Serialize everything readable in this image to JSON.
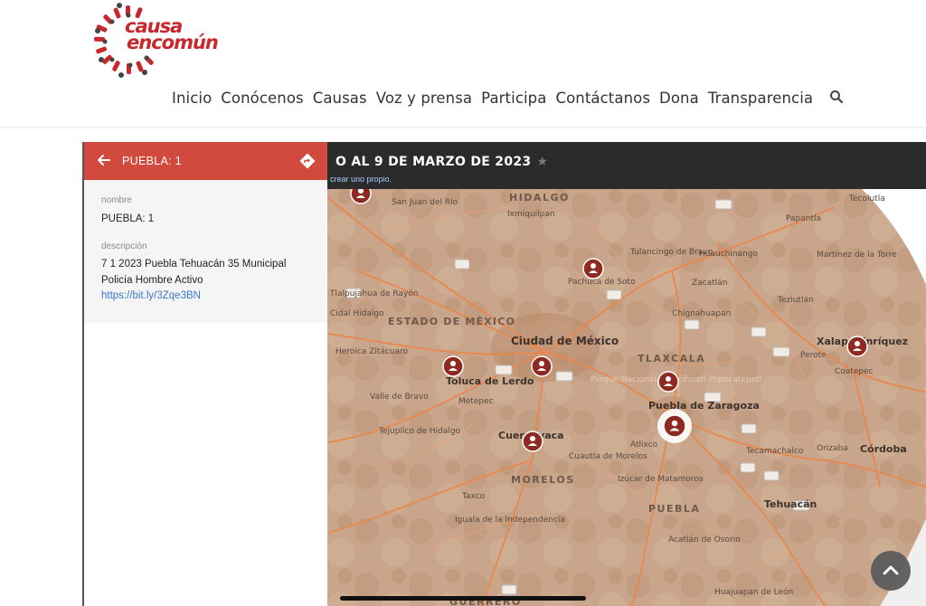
{
  "site": {
    "logo_line1": "causa",
    "logo_line2": "encomún",
    "brand_color": "#c8272d"
  },
  "nav": {
    "items": [
      "Inicio",
      "Conócenos",
      "Causas",
      "Voz y prensa",
      "Participa",
      "Contáctanos",
      "Dona",
      "Transparencia"
    ],
    "search_icon": "search-icon"
  },
  "map": {
    "title_visible": "O AL 9 DE MARZO DE 2023",
    "subtitle_visible": "crear uno propio.",
    "labels": [
      {
        "text": "HIDALGO"
      },
      {
        "text": "San Juan del Río"
      },
      {
        "text": "Ixmiquilpan"
      },
      {
        "text": "Tulancingo de Bravo"
      },
      {
        "text": "Huauchinango"
      },
      {
        "text": "Papantla"
      },
      {
        "text": "Tecolutla"
      },
      {
        "text": "Martínez de la Torre"
      },
      {
        "text": "Pachuca de Soto"
      },
      {
        "text": "Zacatlán"
      },
      {
        "text": "Teziutlán"
      },
      {
        "text": "Tlalpujahua de Rayón"
      },
      {
        "text": "ESTADO DE MÉXICO"
      },
      {
        "text": "Chignahuapan"
      },
      {
        "text": "Ciudad de México"
      },
      {
        "text": "TLAXCALA"
      },
      {
        "text": "Xalapa-Enríquez"
      },
      {
        "text": "Perote"
      },
      {
        "text": "Coatepec"
      },
      {
        "text": "Heroica Zitácuaro"
      },
      {
        "text": "Toluca de Lerdo"
      },
      {
        "text": "Valle de Bravo"
      },
      {
        "text": "Metepec"
      },
      {
        "text": "Parque Nacional Iztaccíhuatl-Popocatépetl"
      },
      {
        "text": "Puebla de Zaragoza"
      },
      {
        "text": "Tejupilco de Hidalgo"
      },
      {
        "text": "Cuernavaca"
      },
      {
        "text": "Atlixco"
      },
      {
        "text": "Tecamachalco"
      },
      {
        "text": "Orizaba"
      },
      {
        "text": "Córdoba"
      },
      {
        "text": "Cuautla de Morelos"
      },
      {
        "text": "MORELOS"
      },
      {
        "text": "Izúcar de Matamoros"
      },
      {
        "text": "Taxco"
      },
      {
        "text": "PUEBLA"
      },
      {
        "text": "Tehuacán"
      },
      {
        "text": "Iguala de la Independencia"
      },
      {
        "text": "Acatlán de Osorio"
      },
      {
        "text": "Huajuapan de León"
      },
      {
        "text": "Cidal Hidalgo"
      },
      {
        "text": "GUERRERO"
      }
    ],
    "markers": [
      {
        "name": "marker-queretaro"
      },
      {
        "name": "marker-pachuca"
      },
      {
        "name": "marker-toluca"
      },
      {
        "name": "marker-cdmx"
      },
      {
        "name": "marker-tlaxcala"
      },
      {
        "name": "marker-puebla-selected"
      },
      {
        "name": "marker-cuernavaca"
      },
      {
        "name": "marker-xalapa"
      }
    ],
    "colors": {
      "land": "#c9a68b",
      "road": "#e8884f",
      "water": "#b8c7cf",
      "topbar": "#2b2b2b",
      "marker": "#8e2a22"
    }
  },
  "panel": {
    "title": "PUEBLA: 1",
    "header_color": "#d24a3e",
    "fields": [
      {
        "label": "nombre",
        "value": "PUEBLA: 1"
      },
      {
        "label": "descripción",
        "value": "7 1 2023 Puebla Tehuacán 35 Municipal Policía Hombre Activo"
      }
    ],
    "link": "https://bit.ly/3Zqe3BN"
  }
}
